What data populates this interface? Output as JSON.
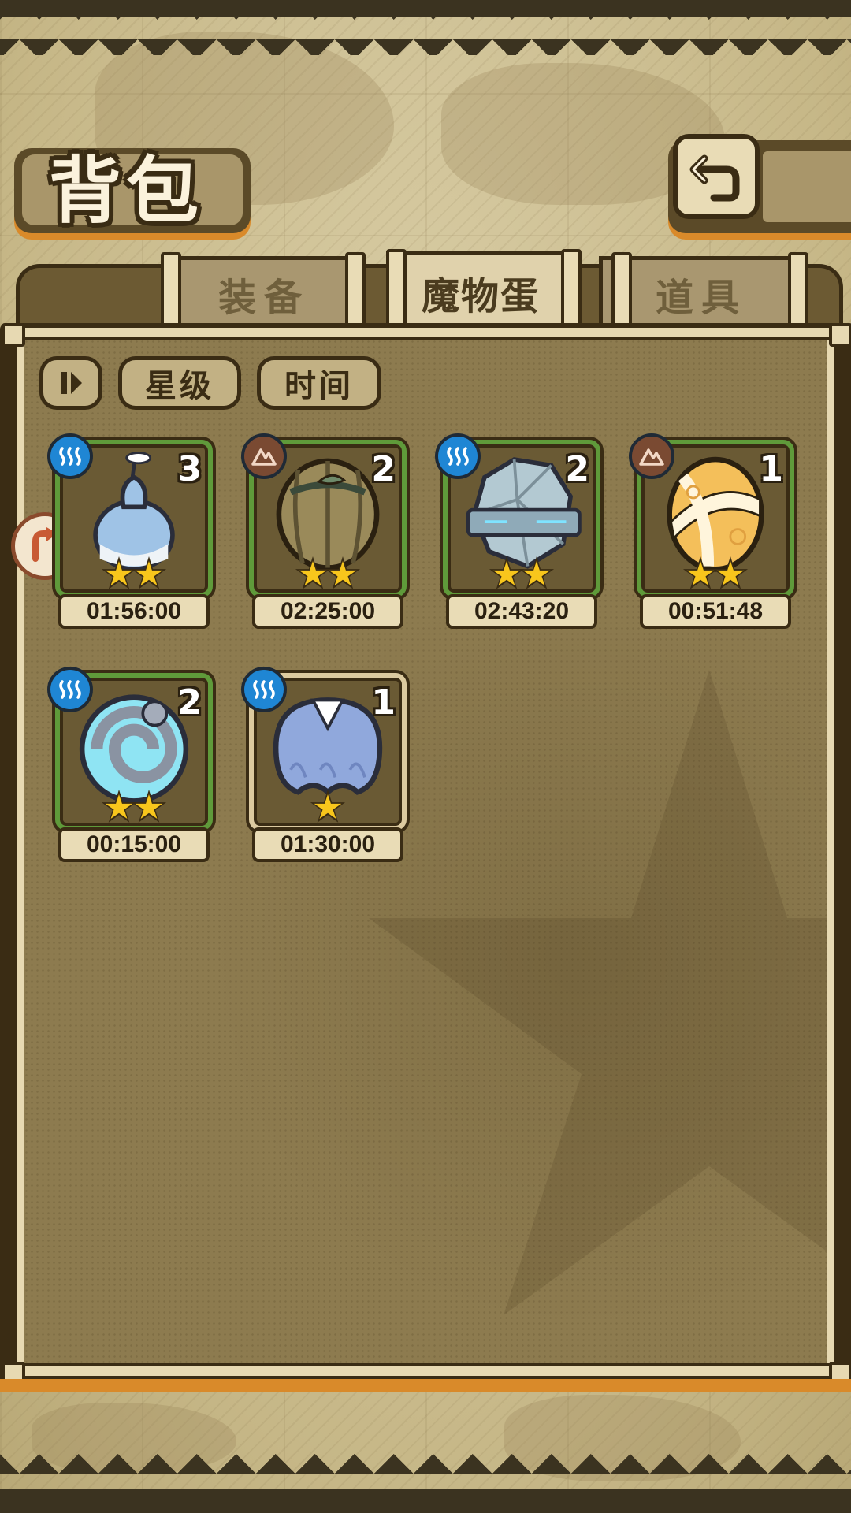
{
  "header": {
    "title": "背包",
    "back_icon": "return-arrow-icon"
  },
  "tabs": [
    {
      "label": "装备",
      "active": false
    },
    {
      "label": "魔物蛋",
      "active": true
    },
    {
      "label": "道具",
      "active": false
    }
  ],
  "sort": {
    "toggle_icon": "sort-order-icon",
    "star_label": "星级",
    "time_label": "时间"
  },
  "side_tab_icon": "redirect-arrow-icon",
  "eggs": [
    {
      "count": "3",
      "element": "water",
      "stars": 2,
      "timer": "01:56:00",
      "art": "blue-gourd-egg"
    },
    {
      "count": "2",
      "element": "earth",
      "stars": 2,
      "timer": "02:25:00",
      "art": "wooden-leaf-egg"
    },
    {
      "count": "2",
      "element": "water",
      "stars": 2,
      "timer": "02:43:20",
      "art": "stone-armored-egg"
    },
    {
      "count": "1",
      "element": "earth",
      "stars": 2,
      "timer": "00:51:48",
      "art": "golden-wrapped-egg"
    },
    {
      "count": "2",
      "element": "water",
      "stars": 2,
      "timer": "00:15:00",
      "art": "spiral-shell-egg"
    },
    {
      "count": "1",
      "element": "water",
      "stars": 1,
      "timer": "01:30:00",
      "art": "blue-jelly-egg"
    }
  ],
  "colors": {
    "panel": "#8d7b4f",
    "frame_dark": "#3a2c14",
    "card_border_green": "#5f9a3a",
    "card_border_tan": "#dccaa0",
    "accent_orange": "#d98a2a",
    "water_badge": "#1f86d4",
    "earth_badge": "#7a4a32",
    "star": "#f8c61c"
  }
}
